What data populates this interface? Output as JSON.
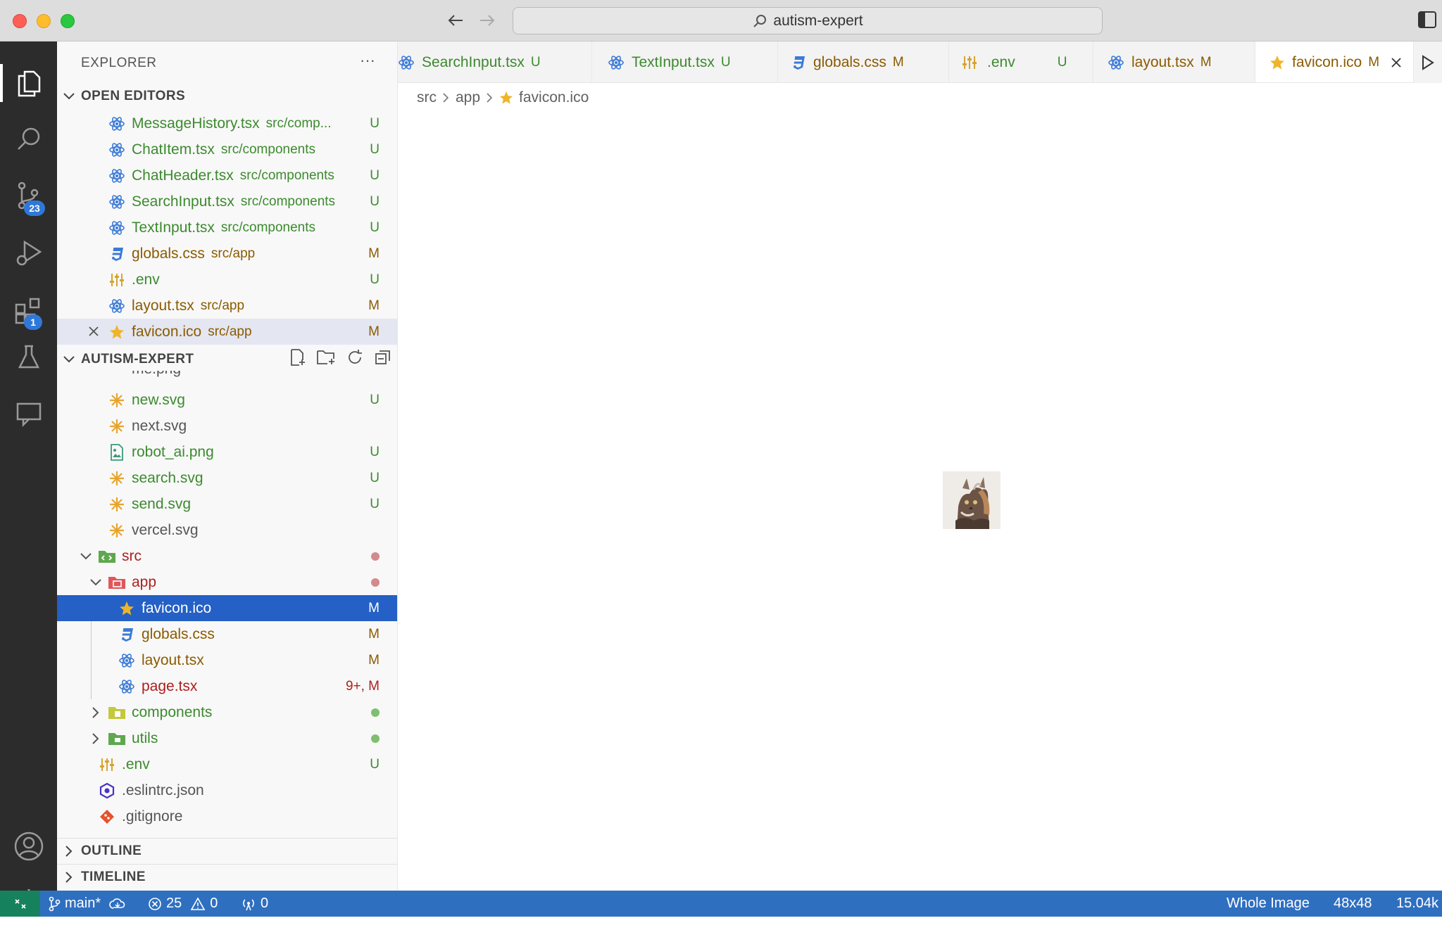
{
  "window": {
    "search_label": "autism-expert"
  },
  "activity_bar": {
    "source_control_badge": "23",
    "extensions_badge": "1"
  },
  "sidebar": {
    "title": "EXPLORER",
    "more": "···",
    "open_editors": {
      "label": "OPEN EDITORS",
      "items": [
        {
          "name": "MessageHistory.tsx",
          "path": "src/comp...",
          "status": "U",
          "icon": "react-icon"
        },
        {
          "name": "ChatItem.tsx",
          "path": "src/components",
          "status": "U",
          "icon": "react-icon"
        },
        {
          "name": "ChatHeader.tsx",
          "path": "src/components",
          "status": "U",
          "icon": "react-icon"
        },
        {
          "name": "SearchInput.tsx",
          "path": "src/components",
          "status": "U",
          "icon": "react-icon"
        },
        {
          "name": "TextInput.tsx",
          "path": "src/components",
          "status": "U",
          "icon": "react-icon"
        },
        {
          "name": "globals.css",
          "path": "src/app",
          "status": "M",
          "icon": "css-icon"
        },
        {
          "name": ".env",
          "path": "",
          "status": "U",
          "icon": "env-icon"
        },
        {
          "name": "layout.tsx",
          "path": "src/app",
          "status": "M",
          "icon": "react-icon"
        },
        {
          "name": "favicon.ico",
          "path": "src/app",
          "status": "M",
          "icon": "star-icon"
        }
      ]
    },
    "project": {
      "label": "AUTISM-EXPERT",
      "partial_top": "me.png",
      "files": [
        {
          "name": "new.svg",
          "status": "U"
        },
        {
          "name": "next.svg",
          "status": ""
        },
        {
          "name": "robot_ai.png",
          "status": "U"
        },
        {
          "name": "search.svg",
          "status": "U"
        },
        {
          "name": "send.svg",
          "status": "U"
        },
        {
          "name": "vercel.svg",
          "status": ""
        }
      ],
      "src": "src",
      "app": "app",
      "app_files": [
        {
          "name": "favicon.ico",
          "status": "M"
        },
        {
          "name": "globals.css",
          "status": "M"
        },
        {
          "name": "layout.tsx",
          "status": "M"
        },
        {
          "name": "page.tsx",
          "status": "9+, M"
        }
      ],
      "components": "components",
      "utils": "utils",
      "root_files": [
        {
          "name": ".env",
          "status": "U"
        },
        {
          "name": ".eslintrc.json",
          "status": ""
        },
        {
          "name": ".gitignore",
          "status": ""
        }
      ]
    },
    "outline": "OUTLINE",
    "timeline": "TIMELINE"
  },
  "tabs": [
    {
      "label": "SearchInput.tsx",
      "status": "U"
    },
    {
      "label": "TextInput.tsx",
      "status": "U"
    },
    {
      "label": "globals.css",
      "status": "M"
    },
    {
      "label": ".env",
      "status": "U"
    },
    {
      "label": "layout.tsx",
      "status": "M"
    },
    {
      "label": "favicon.ico",
      "status": "M"
    }
  ],
  "breadcrumb": [
    "src",
    "app",
    "favicon.ico"
  ],
  "status_bar": {
    "branch": "main*",
    "errors": "25",
    "warnings": "0",
    "ports": "0",
    "image_mode": "Whole Image",
    "dimensions": "48x48",
    "size": "15.04k"
  },
  "colors": {
    "accent": "#2f6fc0",
    "selection": "#2460c5",
    "untracked": "#3c8a2e",
    "modified": "#8a5b00",
    "error": "#ad1f1f"
  }
}
